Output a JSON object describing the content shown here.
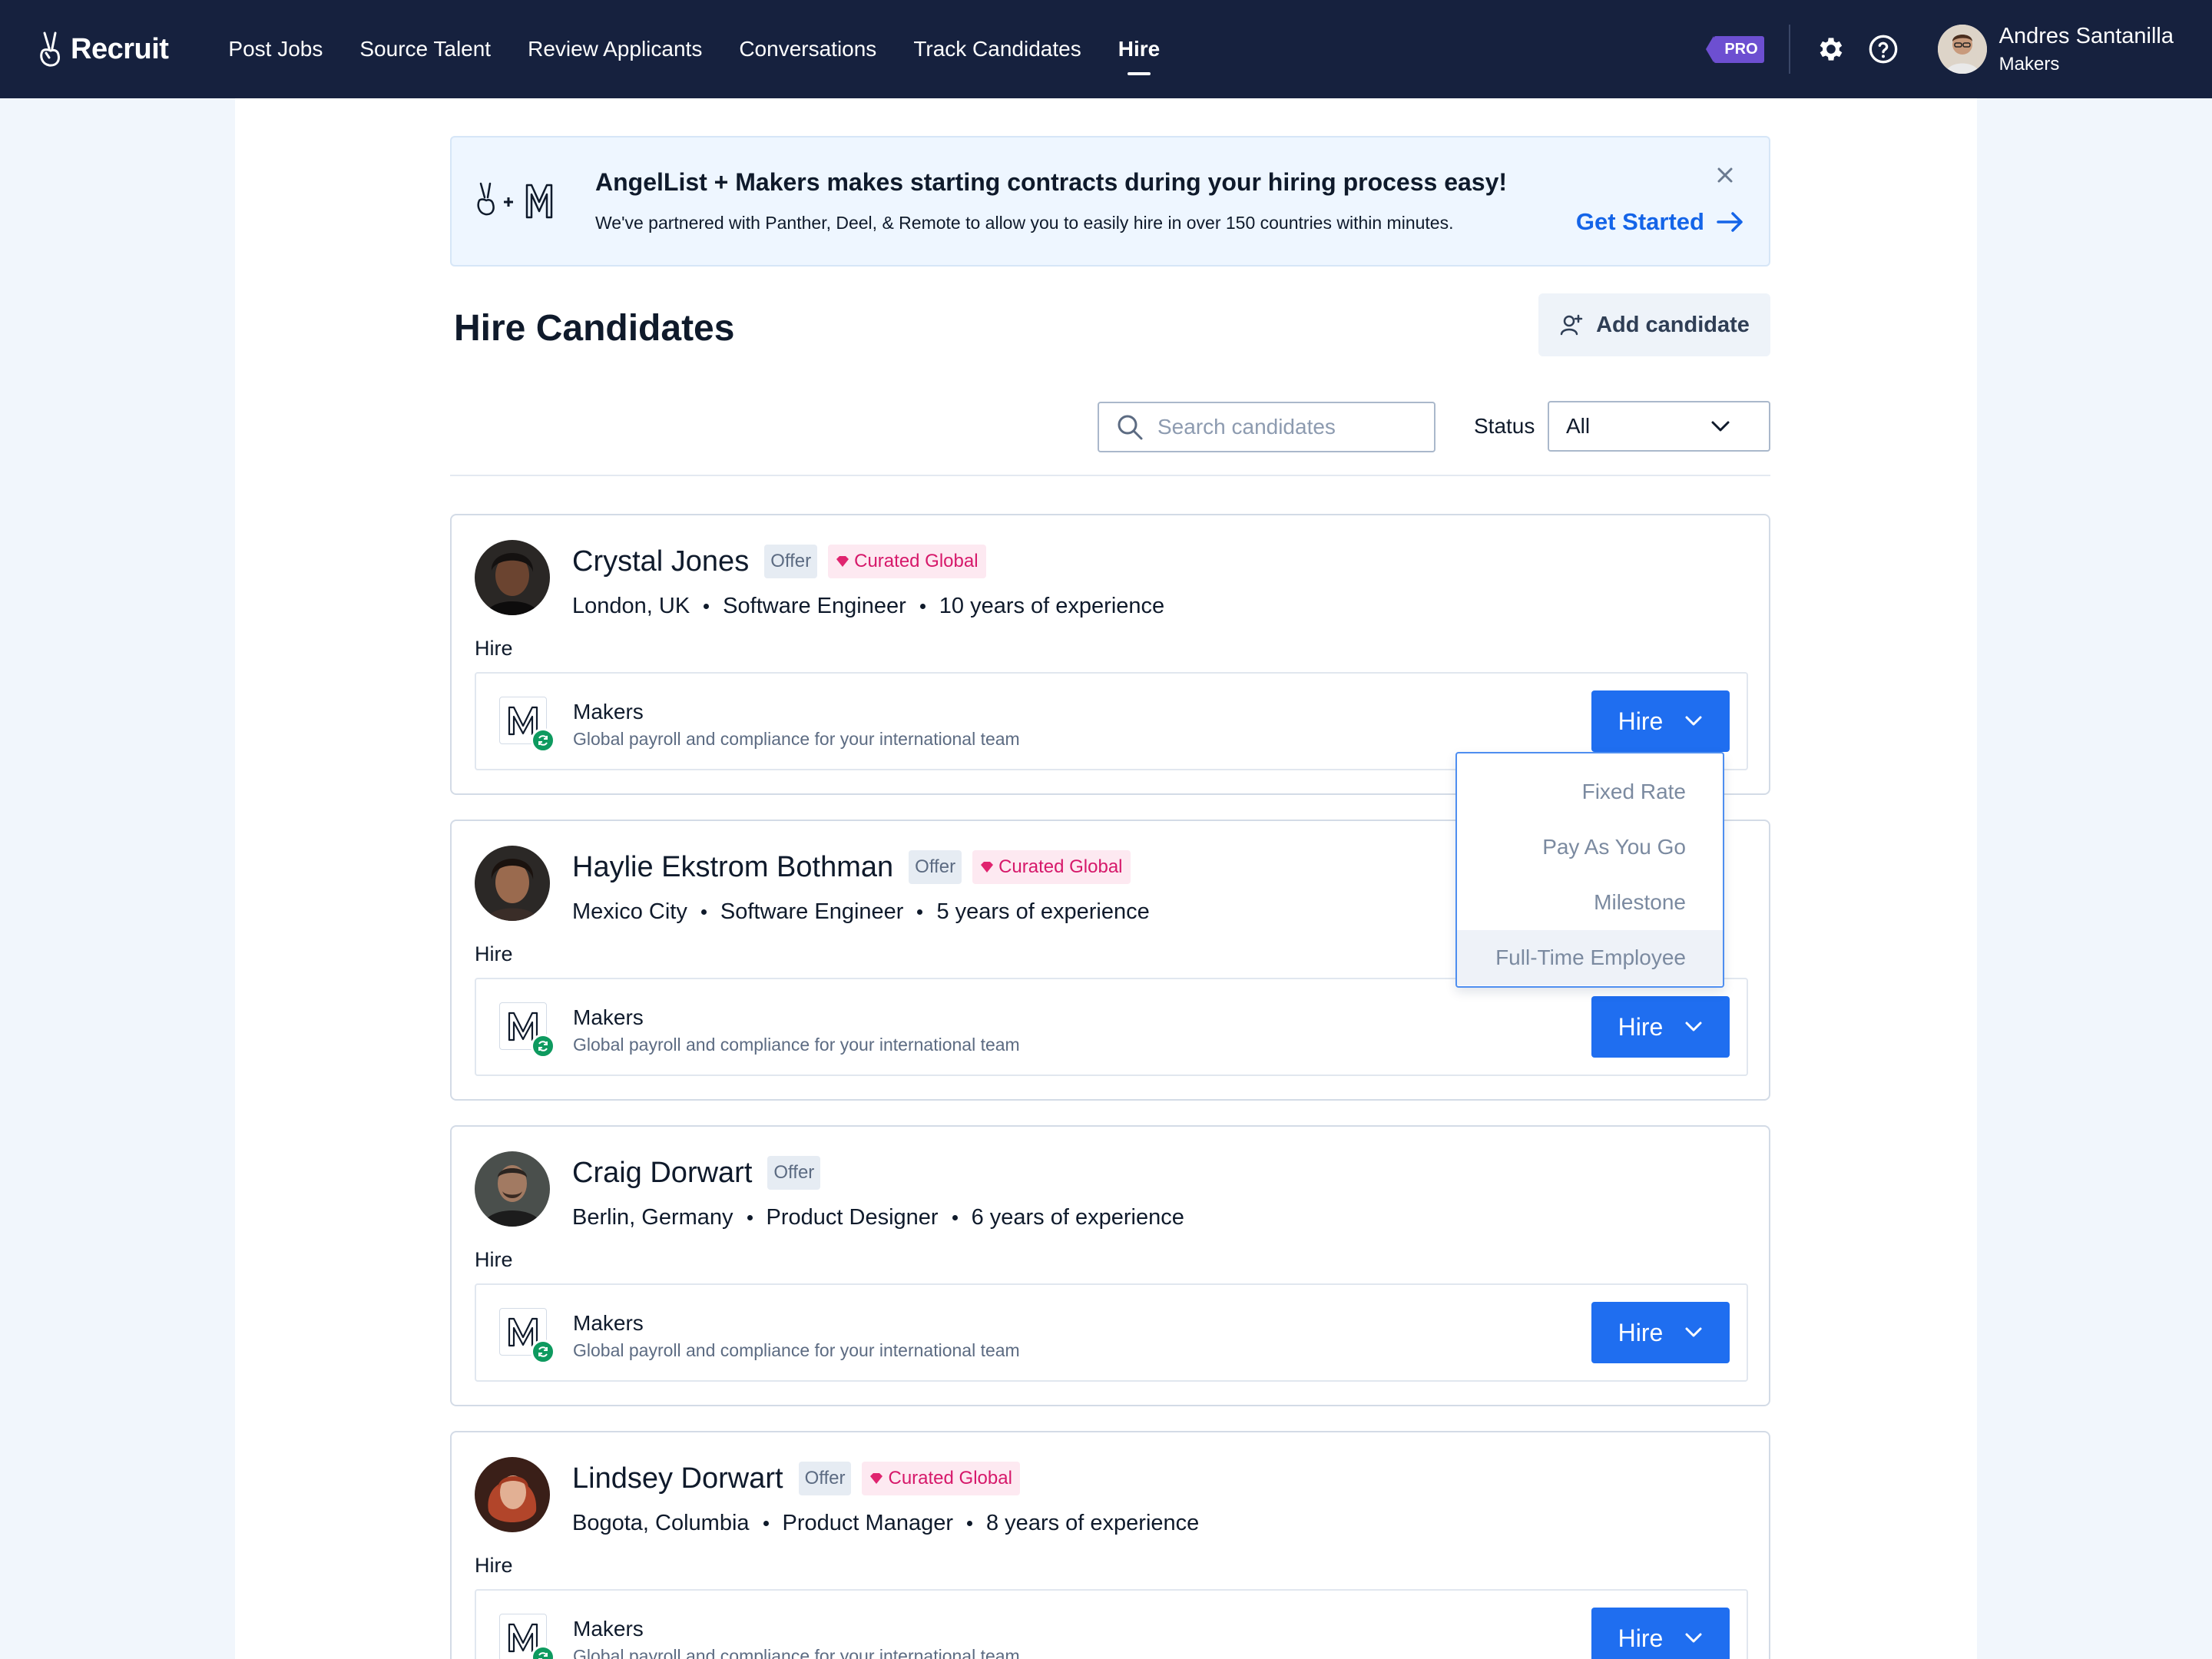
{
  "nav": {
    "brand": "Recruit",
    "links": [
      "Post Jobs",
      "Source Talent",
      "Review Applicants",
      "Conversations",
      "Track Candidates",
      "Hire"
    ],
    "active": "Hire",
    "pro_badge": "PRO",
    "user_name": "Andres Santanilla",
    "user_org": "Makers"
  },
  "banner": {
    "title": "AngelList + Makers makes starting contracts during your hiring process easy!",
    "subtitle": "We've partnered with Panther, Deel, & Remote to allow you to easily hire in over 150 countries within minutes.",
    "cta": "Get Started"
  },
  "page": {
    "title": "Hire Candidates",
    "add_button": "Add candidate",
    "search_placeholder": "Search candidates",
    "status_label": "Status",
    "status_value": "All"
  },
  "candidates": [
    {
      "name": "Crystal Jones",
      "tag_offer": "Offer",
      "tag_curated": "Curated Global",
      "location": "London, UK",
      "role": "Software Engineer",
      "experience": "10 years of experience",
      "hire_label": "Hire",
      "provider": "Makers",
      "provider_sub": "Global payroll and compliance for your international team",
      "hire_button": "Hire"
    },
    {
      "name": "Haylie Ekstrom Bothman",
      "tag_offer": "Offer",
      "tag_curated": "Curated Global",
      "location": "Mexico City",
      "role": "Software Engineer",
      "experience": "5 years of experience",
      "hire_label": "Hire",
      "provider": "Makers",
      "provider_sub": "Global payroll and compliance for your international team",
      "hire_button": "Hire"
    },
    {
      "name": "Craig Dorwart",
      "tag_offer": "Offer",
      "tag_curated": "",
      "location": "Berlin, Germany",
      "role": "Product Designer",
      "experience": "6 years of experience",
      "hire_label": "Hire",
      "provider": "Makers",
      "provider_sub": "Global payroll and compliance for your international team",
      "hire_button": "Hire"
    },
    {
      "name": "Lindsey Dorwart",
      "tag_offer": "Offer",
      "tag_curated": "Curated Global",
      "location": "Bogota, Columbia",
      "role": "Product Manager",
      "experience": "8 years of experience",
      "hire_label": "Hire",
      "provider": "Makers",
      "provider_sub": "Global payroll and compliance for your international team",
      "hire_button": "Hire"
    }
  ],
  "hire_dropdown": {
    "options": [
      "Fixed Rate",
      "Pay As You Go",
      "Milestone",
      "Full-Time Employee"
    ],
    "highlighted": "Full-Time Employee"
  },
  "colors": {
    "nav_bg": "#16213e",
    "primary": "#1f6ef0",
    "pro": "#6d4fd1",
    "curated": "#d6186a",
    "provider_badge": "#0e9a5f"
  }
}
